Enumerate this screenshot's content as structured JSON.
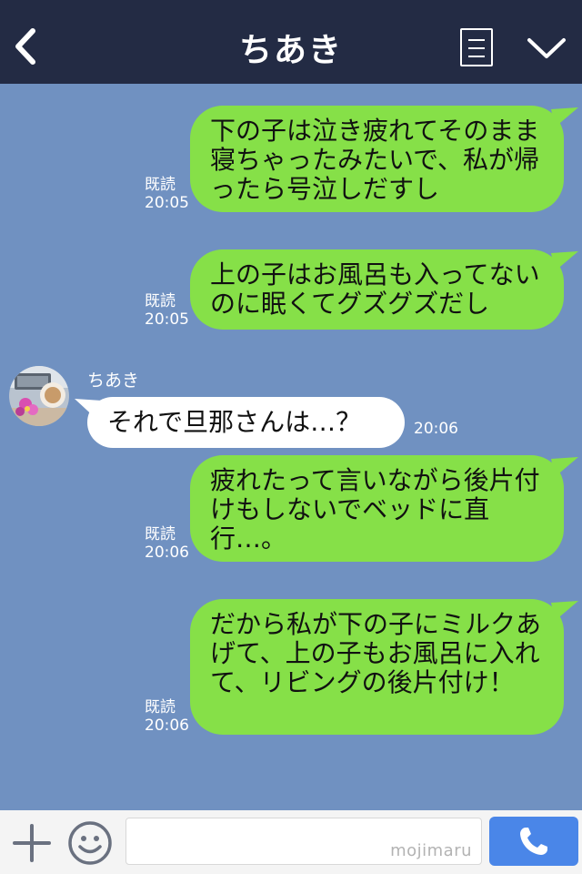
{
  "header": {
    "title": "ちあき"
  },
  "messages": [
    {
      "text": "下の子は泣き疲れてそのまま寝ちゃったみたいで、私が帰ったら号泣しだすし",
      "read": "既読",
      "time": "20:05"
    },
    {
      "text": "上の子はお風呂も入ってないのに眠くてグズグズだし",
      "read": "既読",
      "time": "20:05"
    },
    {
      "sender": "ちあき",
      "text": "それで旦那さんは…？",
      "time": "20:06"
    },
    {
      "text": "疲れたって言いながら後片付けもしないでベッドに直行…。",
      "read": "既読",
      "time": "20:06"
    },
    {
      "text": "だから私が下の子にミルクあげて、上の子もお風呂に入れて、リビングの後片付け！",
      "read": "既読",
      "time": "20:06"
    }
  ],
  "footer": {
    "input_watermark": "mojimaru"
  },
  "colors": {
    "header_bg": "#232b44",
    "chat_bg": "#7091c1",
    "sent_bubble": "#86e048",
    "received_bubble": "#ffffff",
    "call_button": "#4a86e8"
  },
  "icons": [
    "back-icon",
    "menu-icon",
    "chevron-down-icon",
    "avatar",
    "plus-icon",
    "emoji-icon",
    "phone-icon"
  ]
}
